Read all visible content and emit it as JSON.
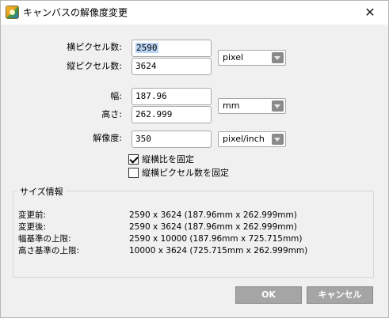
{
  "window": {
    "title": "キャンバスの解像度変更",
    "close_glyph": "✕",
    "app_icon": "app-icon"
  },
  "pixel": {
    "width_label": "横ピクセル数:",
    "width_value": "2590",
    "height_label": "縦ピクセル数:",
    "height_value": "3624",
    "unit": "pixel"
  },
  "size": {
    "width_label": "幅:",
    "width_value": "187.96",
    "height_label": "高さ:",
    "height_value": "262.999",
    "unit": "mm"
  },
  "resolution": {
    "label": "解像度:",
    "value": "350",
    "unit": "pixel/inch"
  },
  "options": {
    "lock_ratio_label": "縦横比を固定",
    "lock_ratio_checked": true,
    "lock_pixels_label": "縦横ピクセル数を固定",
    "lock_pixels_checked": false
  },
  "info": {
    "title": "サイズ情報",
    "rows": [
      {
        "label": "変更前:",
        "value": "2590 x 3624 (187.96mm x 262.999mm)"
      },
      {
        "label": "変更後:",
        "value": "2590 x 3624 (187.96mm x 262.999mm)"
      },
      {
        "label": "幅基準の上限:",
        "value": "2590 x 10000 (187.96mm x 725.715mm)"
      },
      {
        "label": "高さ基準の上限:",
        "value": "10000 x 3624 (725.715mm x 262.999mm)"
      }
    ]
  },
  "buttons": {
    "ok": "OK",
    "cancel": "キャンセル"
  },
  "colors": {
    "button_bg": "#a5a5a5",
    "selection": "#b8d4f2",
    "dialog_bg": "#f0f0f0"
  }
}
